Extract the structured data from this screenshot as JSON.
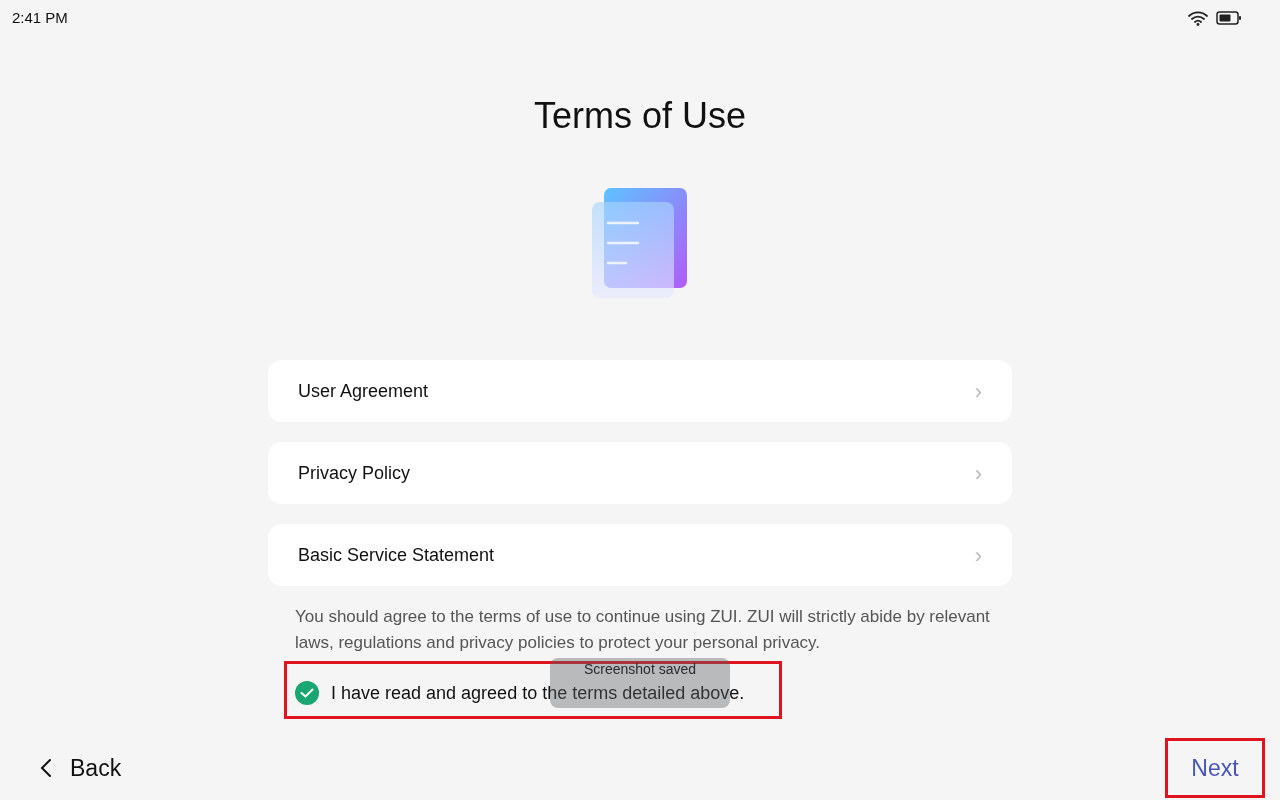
{
  "status_bar": {
    "time": "2:41 PM"
  },
  "title": "Terms of Use",
  "links": [
    {
      "label": "User Agreement",
      "chevron": "›"
    },
    {
      "label": "Privacy Policy",
      "chevron": "›"
    },
    {
      "label": "Basic Service Statement",
      "chevron": "›"
    }
  ],
  "notice": "You should agree to the terms of use to continue using ZUI. ZUI will strictly abide by relevant laws, regulations and privacy policies to protect your personal privacy.",
  "agreement": {
    "label": "I have read and agreed to the terms detailed above.",
    "checked": true,
    "highlighted": true
  },
  "toast": "Screenshot saved",
  "back": {
    "label": "Back"
  },
  "next": {
    "label": "Next",
    "highlighted": true
  }
}
